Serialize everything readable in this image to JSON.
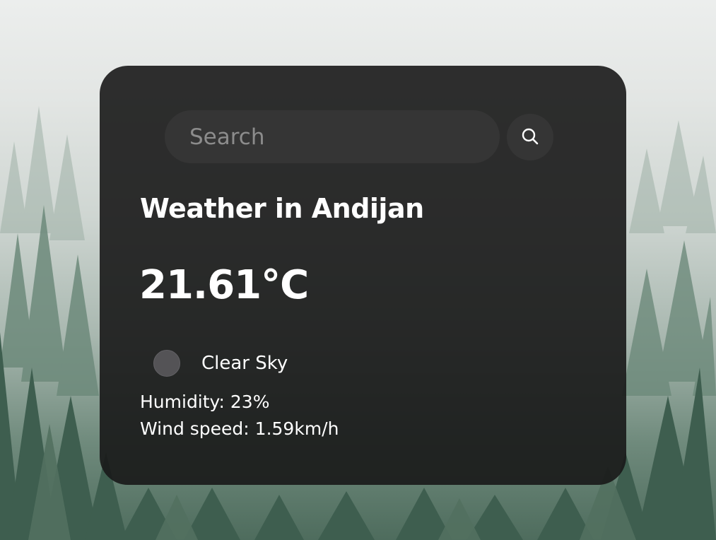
{
  "search": {
    "placeholder": "Search",
    "value": "",
    "button_icon": "search-icon"
  },
  "weather": {
    "title": "Weather in Andijan",
    "temperature": "21.61°C",
    "icon": "weather-condition-icon",
    "description": "Clear Sky",
    "humidity": "Humidity: 23%",
    "wind": "Wind speed: 1.59km/h"
  },
  "colors": {
    "card_background": "#181818",
    "input_background": "#353535",
    "text": "#ffffff",
    "placeholder": "#8c8c8c",
    "forest": "#3f5f50"
  }
}
